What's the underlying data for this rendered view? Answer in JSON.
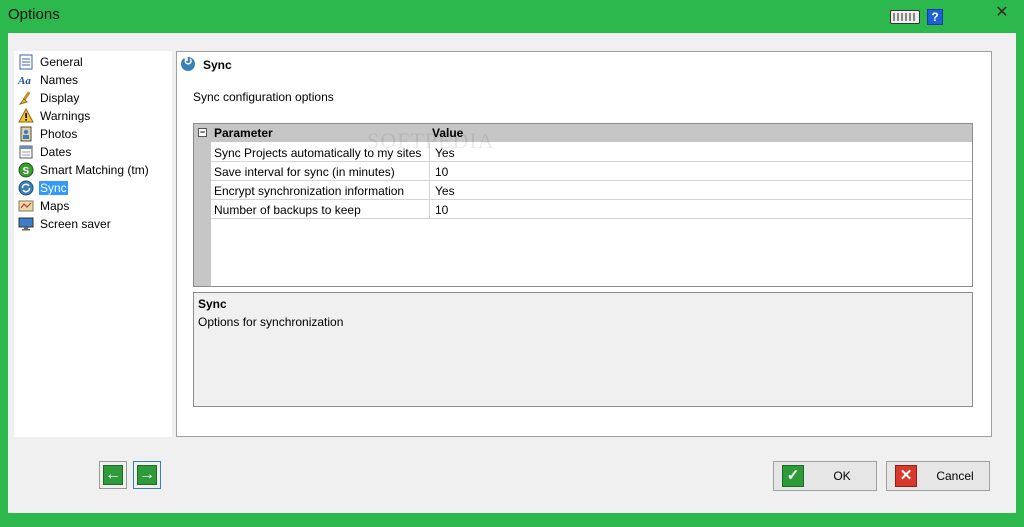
{
  "window": {
    "title": "Options"
  },
  "titlebar_icons": [
    "keyboard-icon",
    "help-icon",
    "close-icon"
  ],
  "help_glyph": "?",
  "close_glyph": "✕",
  "sidebar": {
    "items": [
      {
        "label": "General",
        "icon": "general-icon",
        "selected": false
      },
      {
        "label": "Names",
        "icon": "names-icon",
        "selected": false
      },
      {
        "label": "Display",
        "icon": "display-icon",
        "selected": false
      },
      {
        "label": "Warnings",
        "icon": "warning-icon",
        "selected": false
      },
      {
        "label": "Photos",
        "icon": "photos-icon",
        "selected": false
      },
      {
        "label": "Dates",
        "icon": "dates-icon",
        "selected": false
      },
      {
        "label": "Smart Matching (tm)",
        "icon": "smart-matching-icon",
        "selected": false
      },
      {
        "label": "Sync",
        "icon": "sync-icon",
        "selected": true
      },
      {
        "label": "Maps",
        "icon": "maps-icon",
        "selected": false
      },
      {
        "label": "Screen saver",
        "icon": "screen-saver-icon",
        "selected": false
      }
    ]
  },
  "panel": {
    "title": "Sync",
    "description": "Sync configuration options",
    "grid": {
      "headers": {
        "parameter": "Parameter",
        "value": "Value"
      },
      "rows": [
        {
          "parameter": "Sync Projects automatically to my sites",
          "value": "Yes"
        },
        {
          "parameter": "Save interval for sync (in minutes)",
          "value": "10"
        },
        {
          "parameter": "Encrypt synchronization information",
          "value": "Yes"
        },
        {
          "parameter": "Number of backups to keep",
          "value": "10"
        }
      ]
    },
    "help": {
      "title": "Sync",
      "text": "Options for synchronization"
    }
  },
  "watermark": "SOFTPEDIA",
  "footer": {
    "back_arrow": "←",
    "forward_arrow": "→",
    "ok_label": "OK",
    "cancel_label": "Cancel"
  },
  "colors": {
    "window_frame": "#2db84e",
    "selection": "#3399ff",
    "grid_header": "#c6c6c6",
    "ok_icon": "#2f9a3a",
    "cancel_icon": "#d9382c"
  }
}
